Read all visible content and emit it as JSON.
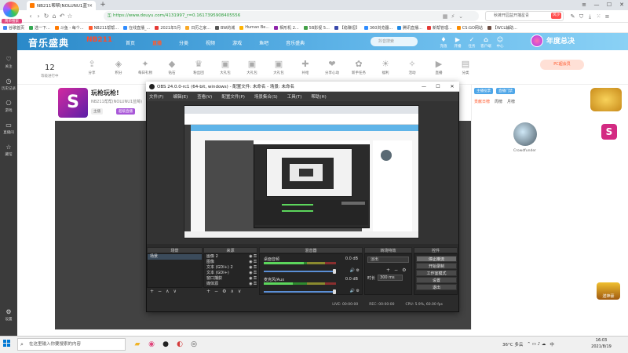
{
  "browser": {
    "logo_label": "简单搜索",
    "tab_title": "NB211帮帮(NOLUNU1蓝?...",
    "new_tab": "+",
    "url": "https://www.douyu.com/4131997_r=0.1617395908405556",
    "search_placeholder": "秋裤开园盆开捕星青",
    "search_badge": "风沙",
    "bookmarks": [
      {
        "label": "谷歌首页",
        "color": "#4285f4"
      },
      {
        "label": "选一下...",
        "color": "#34a853"
      },
      {
        "label": "斗鱼 - 每个...",
        "color": "#ff7a00"
      },
      {
        "label": "NB211帮帮...",
        "color": "#ff5a2e"
      },
      {
        "label": "在线直播_...",
        "color": "#2f8cff"
      },
      {
        "label": "2021年5月",
        "color": "#e53935"
      },
      {
        "label": "日历之家...",
        "color": "#f9a825"
      },
      {
        "label": "BW的城",
        "color": "#555555"
      },
      {
        "label": "Human Be...",
        "color": "#ffb300"
      },
      {
        "label": "相形机 2...",
        "color": "#8e24aa"
      },
      {
        "label": "5B影视 5...",
        "color": "#43a047"
      },
      {
        "label": "【稳赚坦】",
        "color": "#3949ab"
      },
      {
        "label": "360浏览器...",
        "color": "#2f8cff"
      },
      {
        "label": "腾讯直播...",
        "color": "#1e88e5"
      },
      {
        "label": "新帮管理...",
        "color": "#e53935"
      },
      {
        "label": "CS:GO网站",
        "color": "#fb8c00"
      },
      {
        "label": "【WCL辅助...",
        "color": "#6d4c41"
      }
    ]
  },
  "left_sidebar": [
    {
      "label": "关注",
      "icon": "heart-icon"
    },
    {
      "label": "历史记录",
      "icon": "history-icon"
    },
    {
      "label": "游戏",
      "icon": "gamepad-icon"
    },
    {
      "label": "直播间",
      "icon": "tv-icon"
    },
    {
      "label": "藏馆",
      "icon": "star-icon"
    }
  ],
  "sidebar_bottom": "设置",
  "douyu": {
    "logo_text": "音乐盛典",
    "badge": "NB211",
    "nav": [
      "首页",
      "直播",
      "分类",
      "视频",
      "游戏",
      "鱼吧",
      "音乐盛典"
    ],
    "active_nav": 1,
    "search_placeholder": "抖音搜索",
    "header_icons": [
      "充值",
      "开播",
      "任务",
      "客户端",
      "中心"
    ],
    "banner": "年度总决",
    "level_num": "12",
    "level_label": "等级进行中",
    "gifts": [
      "分享",
      "积分",
      "每日礼物",
      "钻石",
      "粉丝团",
      "大礼包",
      "大礼包",
      "大礼包",
      "补给",
      "分享心动",
      "新手任务",
      "福利",
      "活动",
      "直播",
      "分类"
    ],
    "promo": "PC超会员"
  },
  "room": {
    "avatar_letter": "S",
    "title": "玩枪玩枪!",
    "sub": "NB211帮帮(NOLUNU1蓝莓)",
    "tag1": "主播",
    "tag2": "超级直播"
  },
  "ranking": {
    "tabs": [
      "贡献日榜",
      "周榜",
      "月榜"
    ],
    "active": 0,
    "buttons": [
      "主播投票",
      "直播门禁"
    ],
    "streamer": "Crowdfunder"
  },
  "right_promo": {
    "live": "送神豪"
  },
  "obs": {
    "title": "OBS 24.0.0-rc1 (64-bit, windows) - 配置文件: 未命名 - 场景: 未命名",
    "menu": [
      "文件(F)",
      "编辑(E)",
      "查看(V)",
      "配置文件(P)",
      "场景集合(S)",
      "工具(T)",
      "帮助(H)"
    ],
    "docks": {
      "scenes": "场景",
      "sources": "来源",
      "mixer": "混音器",
      "transitions": "转场特效",
      "controls": "控件"
    },
    "scene_items": [
      "场景"
    ],
    "source_items": [
      "图像 2",
      "图像",
      "文本 (GDI+) 2",
      "文本 (GDI+)",
      "窗口捕获",
      "媒体源"
    ],
    "mixer_tracks": [
      {
        "name": "桌面音频",
        "db": "0.0 dB",
        "level": 0.55
      },
      {
        "name": "麦克风/Aux",
        "db": "0.0 dB",
        "level": 0.4
      }
    ],
    "transition": {
      "type": "淡出",
      "duration_label": "时长",
      "duration": "300 ms"
    },
    "controls": [
      "停止推流",
      "开始录制",
      "工作室模式",
      "设置",
      "退出"
    ],
    "status": {
      "live": "LIVE: 00:00:00",
      "rec": "REC: 00:00:00",
      "cpu": "CPU: 5.9%, 60.00 fps"
    }
  },
  "taskbar": {
    "search_placeholder": "在这里输入你要搜索的内容",
    "weather": "36°C 多云",
    "ime": "中",
    "time": "16:03",
    "date": "2021/8/19"
  }
}
